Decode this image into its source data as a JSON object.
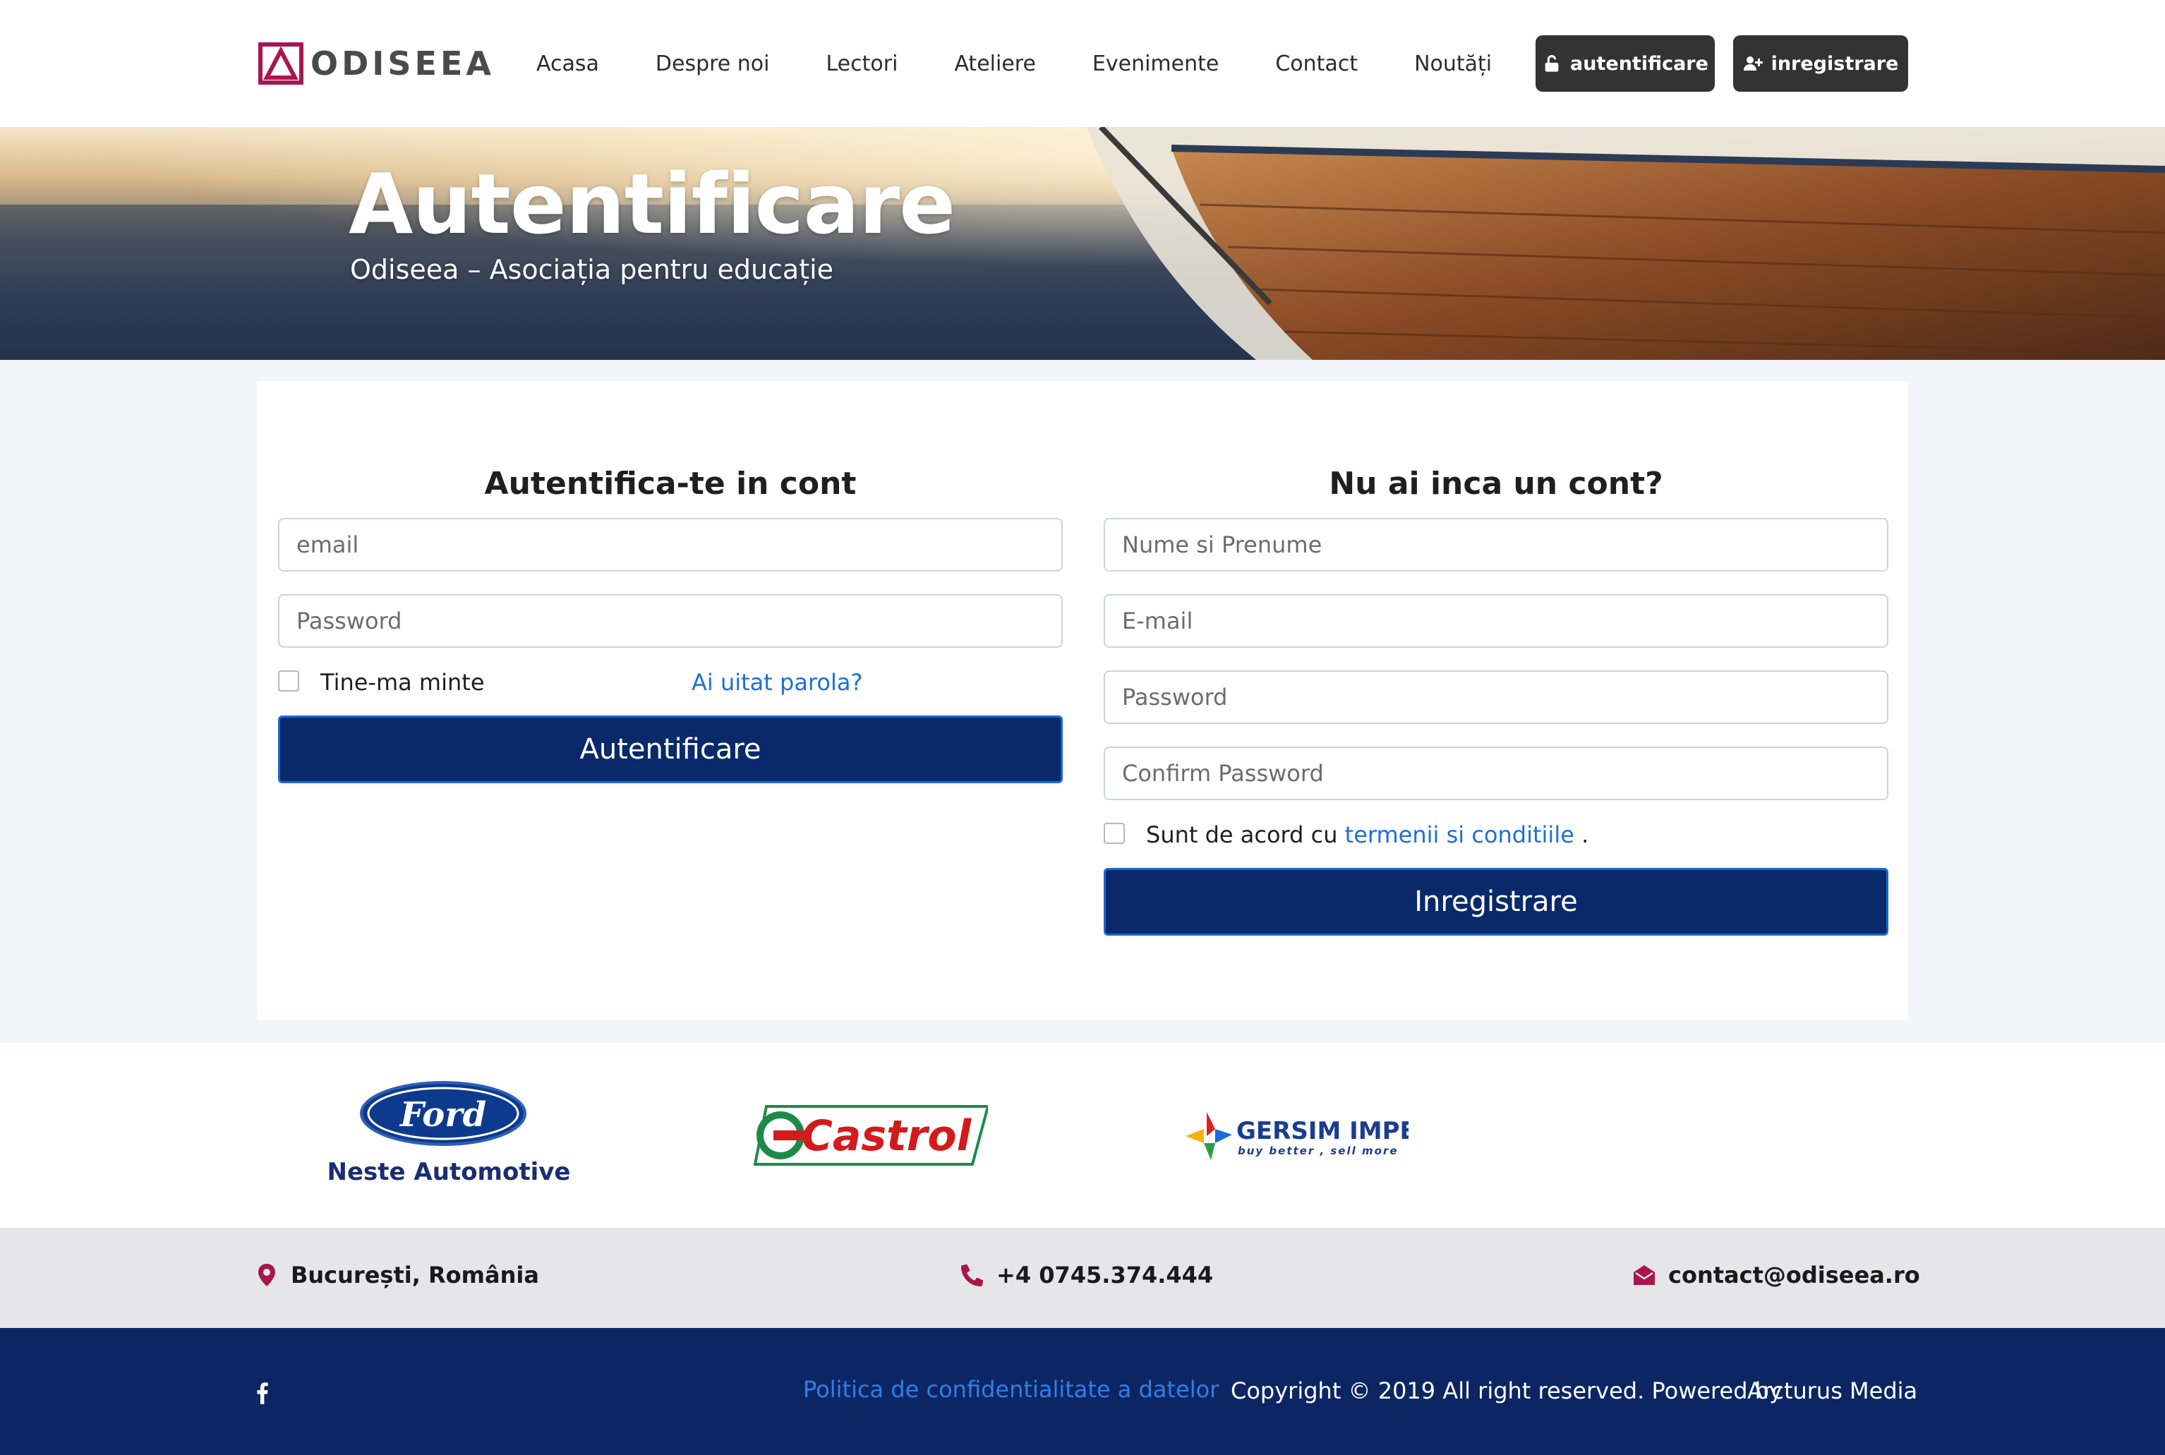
{
  "header": {
    "logo_text": "ODISEEA",
    "nav": [
      "Acasa",
      "Despre noi",
      "Lectori",
      "Ateliere",
      "Evenimente",
      "Contact",
      "Noutăți"
    ],
    "login_button": "autentificare",
    "register_button": "inregistrare",
    "colors": {
      "button_bg": "#333333",
      "logo_accent": "#a8164f"
    }
  },
  "hero": {
    "title": "Autentificare",
    "subtitle": "Odiseea – Asociația pentru educație"
  },
  "login": {
    "title": "Autentifica-te in cont",
    "email_placeholder": "email",
    "password_placeholder": "Password",
    "remember_label": "Tine-ma minte",
    "forgot_link": "Ai uitat parola?",
    "submit": "Autentificare"
  },
  "register": {
    "title": "Nu ai inca un cont?",
    "name_placeholder": "Nume si Prenume",
    "email_placeholder": "E-mail",
    "password_placeholder": "Password",
    "confirm_placeholder": "Confirm Password",
    "terms_prefix": "Sunt de acord cu",
    "terms_link": "termenii si conditiile",
    "terms_suffix": ".",
    "submit": "Inregistrare"
  },
  "sponsors": {
    "ford_oval": "Ford",
    "ford_caption": "Neste Automotive",
    "castrol": "Castrol",
    "gersim_name": "GERSIM IMPEX",
    "gersim_tagline": "buy better , sell more"
  },
  "contact": {
    "location": "București, România",
    "phone": "+4 0745.374.444",
    "email": "contact@odiseea.ro"
  },
  "footer": {
    "privacy_link": "Politica de confidentialitate a datelor",
    "copyright": "Copyright © 2019 All right reserved. Powered by",
    "brand": "Arcturus Media"
  },
  "colors": {
    "primary_button": "#09296b",
    "button_border": "#1a67d2",
    "link": "#1d6fd8",
    "footer_bg": "#0b2663",
    "contact_icon": "#a8164f"
  }
}
